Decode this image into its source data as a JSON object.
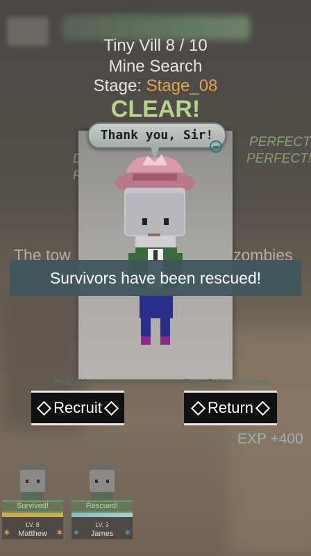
{
  "header": {
    "line1": "Tiny Vill 8 / 10",
    "line2": "Mine Search",
    "stage_label": "Stage:",
    "stage_value": "Stage_08",
    "result": "CLEAR!"
  },
  "side": {
    "perfect1": "PERFECT!",
    "perfect2": "PERFECT!",
    "town_text": "The tow",
    "zombies_text": "zombies",
    "left_frag1": "D",
    "left_frag2": "R"
  },
  "dialog": {
    "speech": "Thank you, Sir!",
    "banner": "Survivors have been rescued!"
  },
  "actions": {
    "prob_label": "Prob: 50 %",
    "bonus_label": "Town Defence Bonus",
    "recruit_label": "Recruit",
    "return_label": "Return",
    "exp": "EXP +400"
  },
  "party": [
    {
      "status": "Survived!",
      "level": "LV. 8",
      "name": "Matthew",
      "star_color": "#e3a54c"
    },
    {
      "status": "Rescued!",
      "level": "LV. 3",
      "name": "James",
      "star_color": "#4a9ab4"
    }
  ],
  "colors": {
    "accent_stage": "#e3a54c",
    "clear": "#b9d28a",
    "perfect": "#8aa06c"
  }
}
